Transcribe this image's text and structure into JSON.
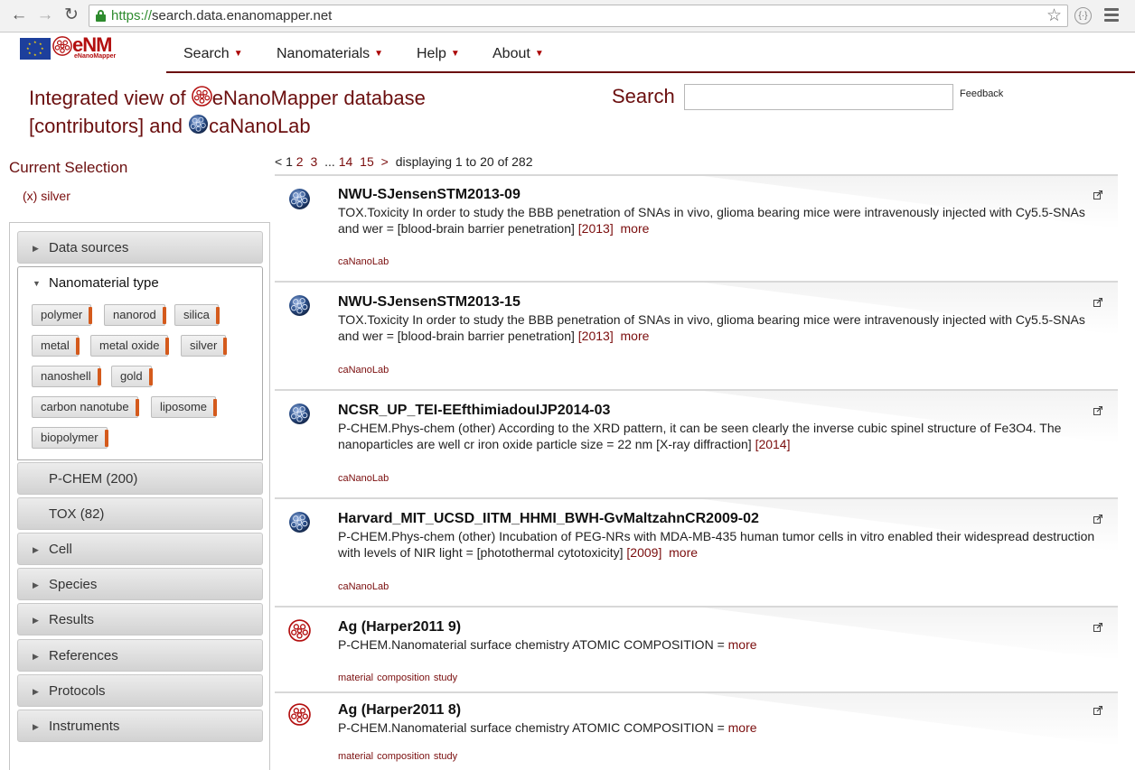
{
  "browser": {
    "url_scheme": "https://",
    "url_host": "search.data.enanomapper.net",
    "back_icon": "arrow-left-icon",
    "forward_icon": "arrow-right-icon",
    "reload_icon": "reload-icon",
    "bookmark_icon": "star-icon",
    "extension_icon": "extension-icon",
    "menu_icon": "hamburger-icon"
  },
  "logo": {
    "text": "eNM",
    "subtext": "eNanoMapper"
  },
  "nav": {
    "items": [
      "Search",
      "Nanomaterials",
      "Help",
      "About"
    ]
  },
  "header": {
    "prefix": "Integrated view of ",
    "db_link": "eNanoMapper",
    "db_suffix": " database",
    "contributors": "[contributors]",
    "and": " and ",
    "cananolab": "caNanoLab",
    "search_label": "Search",
    "search_value": "",
    "feedback": "Feedback"
  },
  "selection": {
    "title": "Current Selection",
    "active": "(x) silver"
  },
  "facets": {
    "data_sources": "Data sources",
    "nanomaterial_type": "Nanomaterial type",
    "chips": [
      "polymer",
      "nanorod",
      "silica",
      "metal",
      "metal oxide",
      "silver",
      "nanoshell",
      "gold",
      "carbon nanotube",
      "liposome",
      "biopolymer"
    ],
    "pchem": "P-CHEM (200)",
    "tox": "TOX (82)",
    "cell": "Cell",
    "species": "Species",
    "results": "Results",
    "references": "References",
    "protocols": "Protocols",
    "instruments": "Instruments"
  },
  "pager": {
    "prev": "<",
    "current": "1",
    "p2": "2",
    "p3": "3",
    "ellipsis": "...",
    "p14": "14",
    "p15": "15",
    "next": ">",
    "summary": "displaying 1 to 20 of 282"
  },
  "results": [
    {
      "icon": "cananolab-ball-icon",
      "title": "NWU-SJensenSTM2013-09",
      "desc": "TOX.Toxicity In order to study the BBB penetration of SNAs in vivo, glioma bearing mice were intravenously injected with Cy5.5-SNAs and wer = [blood-brain barrier penetration] ",
      "year": "[2013]",
      "more": "more",
      "tags": [
        "caNanoLab"
      ]
    },
    {
      "icon": "cananolab-ball-icon",
      "title": "NWU-SJensenSTM2013-15",
      "desc": "TOX.Toxicity In order to study the BBB penetration of SNAs in vivo, glioma bearing mice were intravenously injected with Cy5.5-SNAs and wer = [blood-brain barrier penetration] ",
      "year": "[2013]",
      "more": "more",
      "tags": [
        "caNanoLab"
      ]
    },
    {
      "icon": "cananolab-ball-icon",
      "title": "NCSR_UP_TEI-EEfthimiadouIJP2014-03",
      "desc": "P-CHEM.Phys-chem (other) According to the XRD pattern, it can be seen clearly the inverse cubic spinel structure of Fe3O4. The nanoparticles are well cr iron oxide particle size = 22 nm [X-ray diffraction] ",
      "year": "[2014]",
      "more": "",
      "tags": [
        "caNanoLab"
      ]
    },
    {
      "icon": "cananolab-ball-icon",
      "title": "Harvard_MIT_UCSD_IITM_HHMI_BWH-GvMaltzahnCR2009-02",
      "desc": "P-CHEM.Phys-chem (other) Incubation of PEG-NRs with MDA-MB-435 human tumor cells in vitro enabled their widespread destruction with levels of NIR light = [photothermal cytotoxicity] ",
      "year": "[2009]",
      "more": "more",
      "tags": [
        "caNanoLab"
      ]
    },
    {
      "icon": "enanomapper-ball-icon",
      "title": "Ag (Harper2011 9)",
      "desc": "P-CHEM.Nanomaterial surface chemistry ATOMIC COMPOSITION = ",
      "year": "",
      "more": "more",
      "tags": [
        "material",
        "composition",
        "study"
      ]
    },
    {
      "icon": "enanomapper-ball-icon",
      "title": "Ag (Harper2011 8)",
      "desc": "P-CHEM.Nanomaterial surface chemistry ATOMIC COMPOSITION = ",
      "year": "",
      "more": "more",
      "tags": [
        "material",
        "composition",
        "study"
      ]
    }
  ],
  "colors": {
    "brand": "#6b0f0f",
    "chip_accent": "#d45a1c",
    "cananolab_ball": "#2b4f8a",
    "enm_ball": "#b30f0f"
  }
}
